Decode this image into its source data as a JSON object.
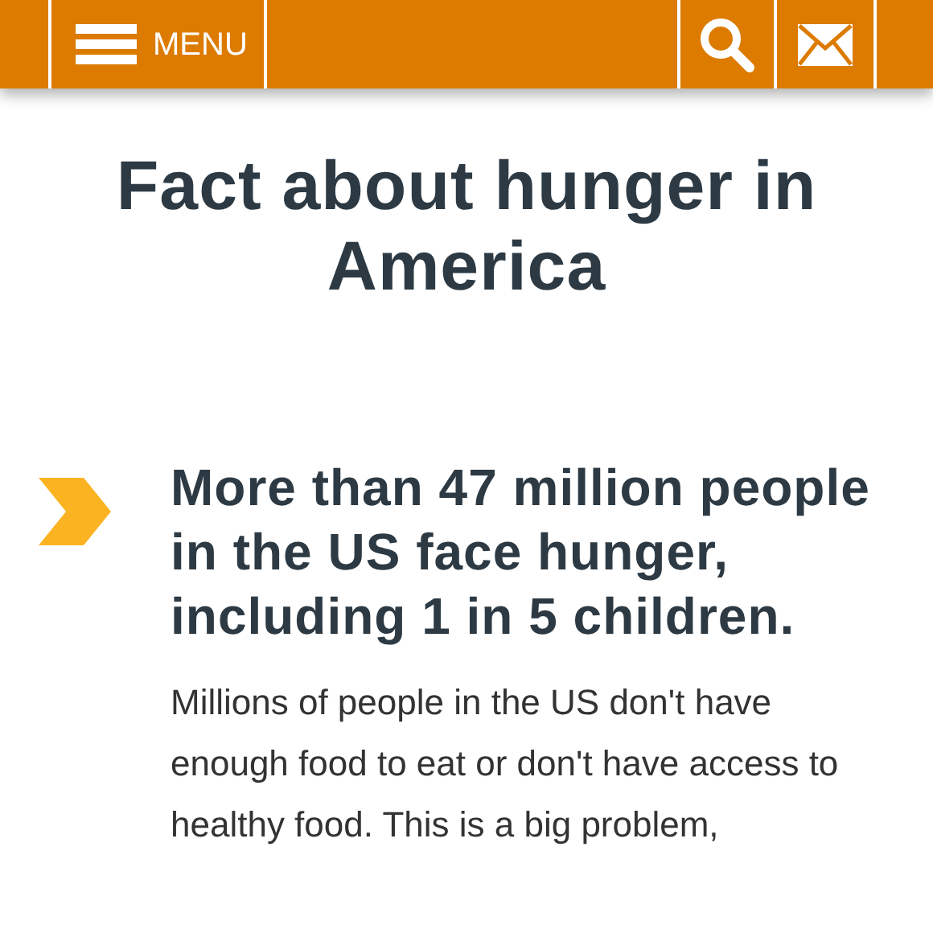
{
  "header": {
    "menu_label": "MENU"
  },
  "title": "Fact about hunger in America",
  "section": {
    "heading": "More than 47 million people in the US face hunger, including 1 in 5 children.",
    "body": "Millions of people in the US don't have enough food to eat or don't have access to healthy food. This is a big problem,"
  }
}
